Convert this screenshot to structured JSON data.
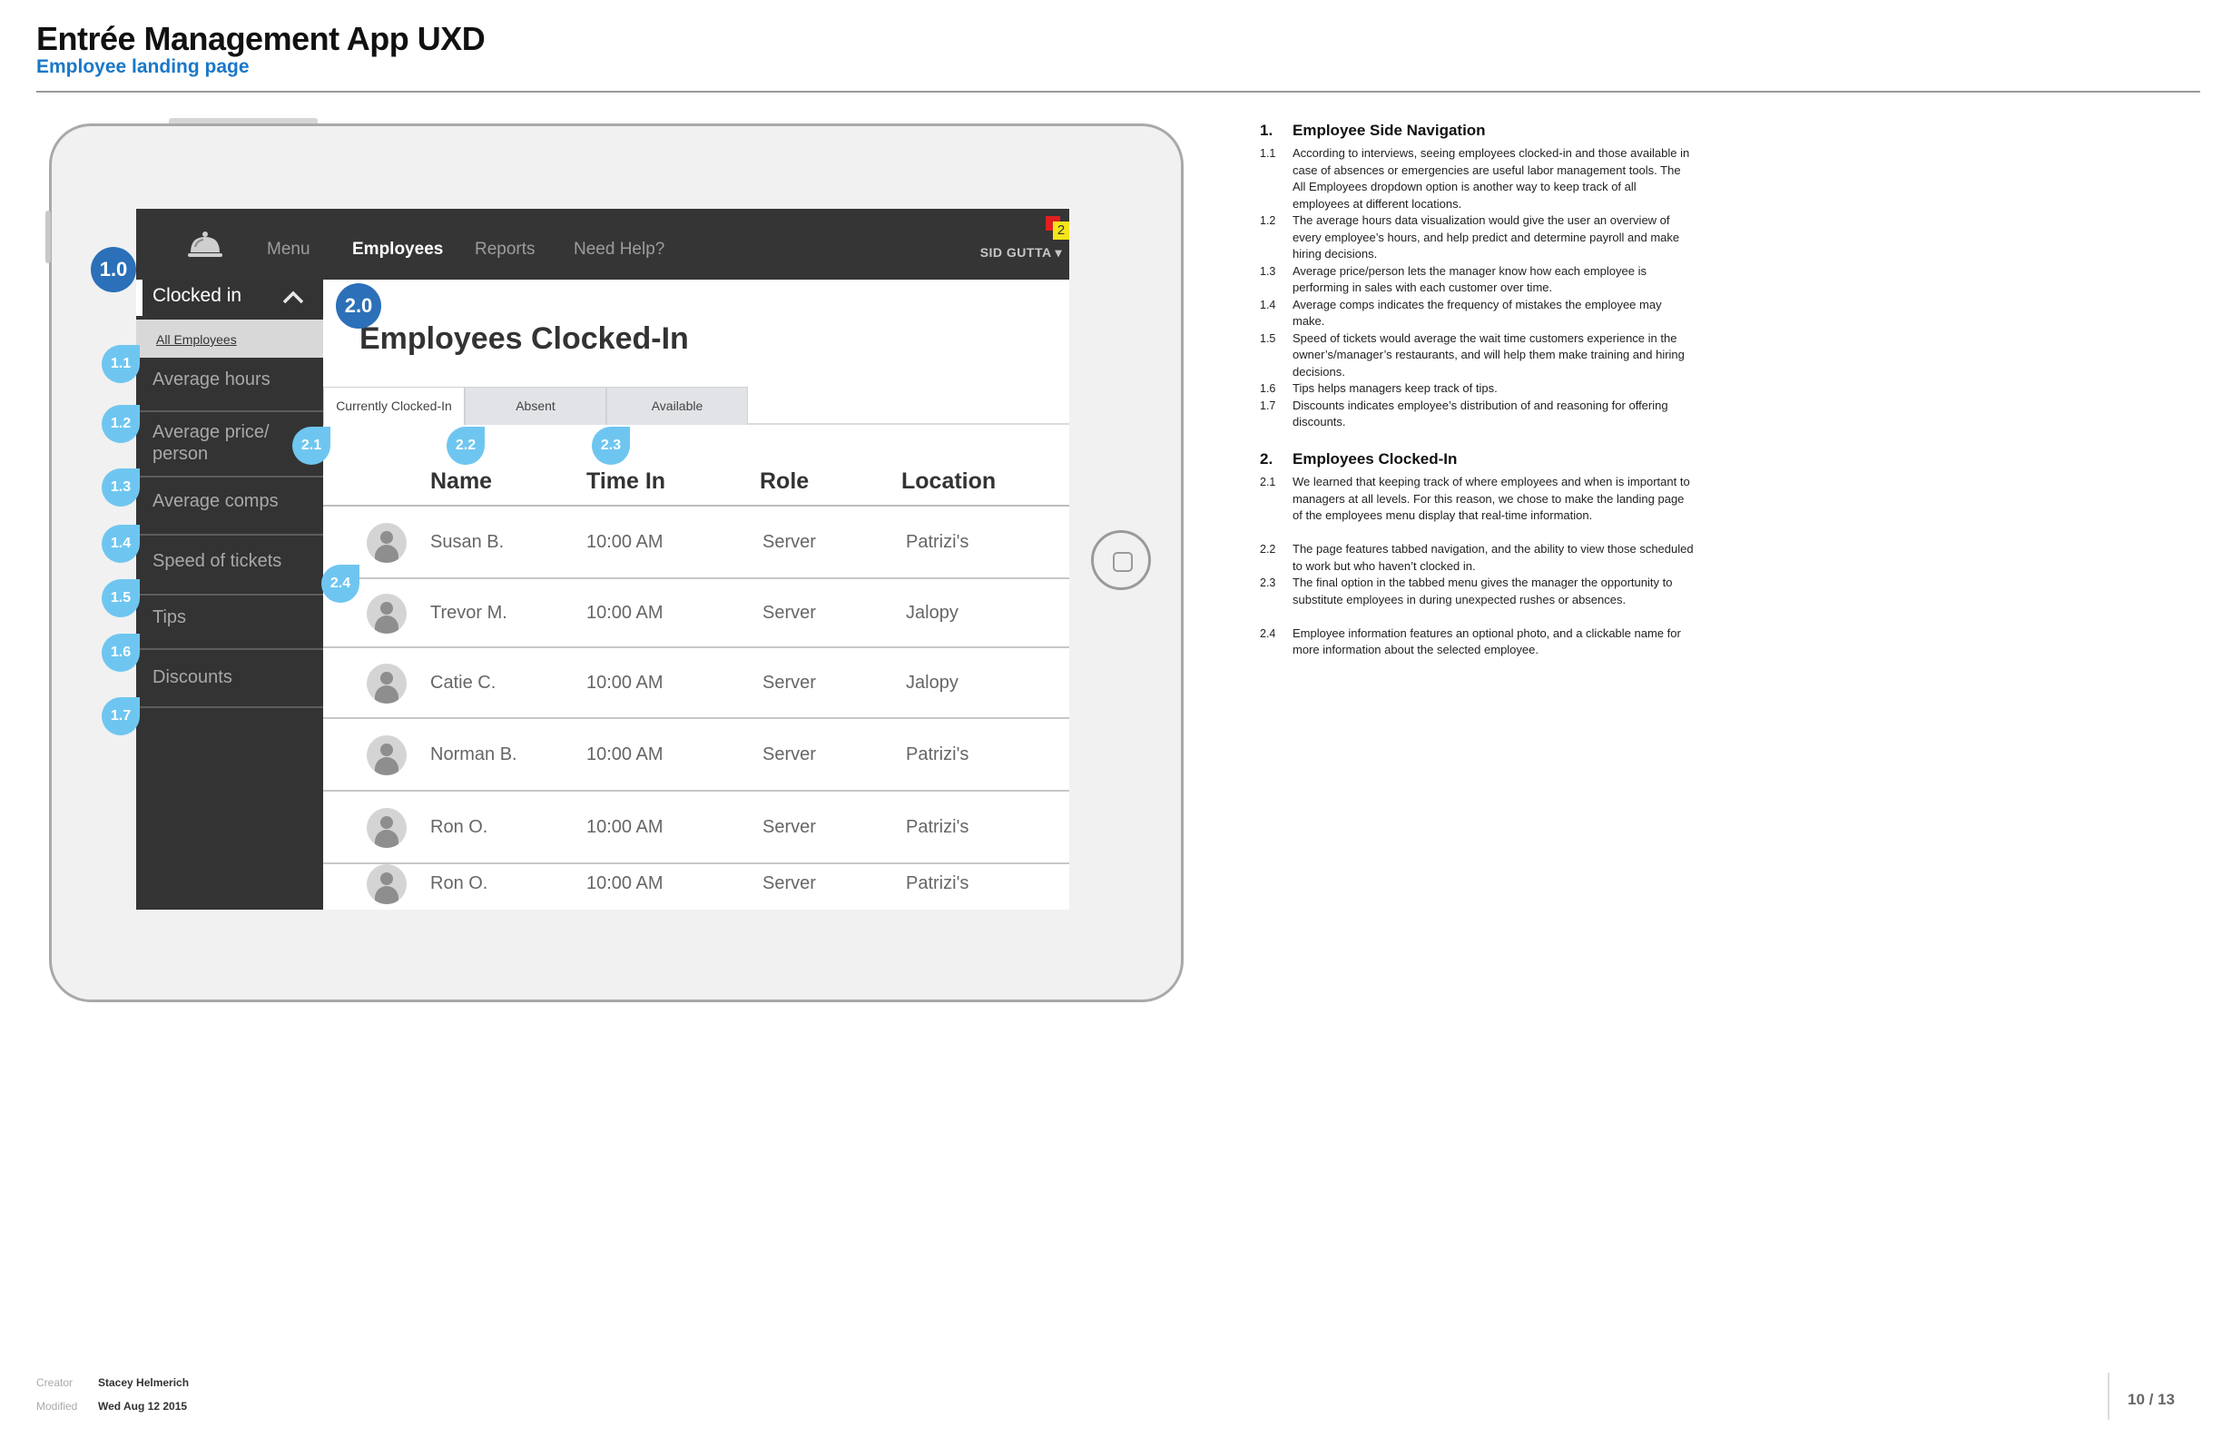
{
  "doc": {
    "title": "Entrée Management App UXD",
    "subtitle": "Employee landing page"
  },
  "app": {
    "nav": {
      "menu": "Menu",
      "employees": "Employees",
      "reports": "Reports",
      "help": "Need Help?"
    },
    "user_menu": "SID GUTTA ▾",
    "notification_count": "2",
    "sidebar": {
      "header": "Clocked in",
      "all_employees": "All Employees",
      "items": [
        "Average hours",
        "Average price/\nperson",
        "Average comps",
        "Speed of tickets",
        "Tips",
        "Discounts"
      ]
    },
    "heading": "Employees Clocked-In",
    "tabs": [
      "Currently Clocked-In",
      "Absent",
      "Available"
    ],
    "columns": [
      "Name",
      "Time In",
      "Role",
      "Location"
    ],
    "rows": [
      {
        "name": "Susan B.",
        "time": "10:00 AM",
        "role": "Server",
        "location": "Patrizi's"
      },
      {
        "name": "Trevor M.",
        "time": "10:00 AM",
        "role": "Server",
        "location": "Jalopy"
      },
      {
        "name": "Catie C.",
        "time": "10:00 AM",
        "role": "Server",
        "location": "Jalopy"
      },
      {
        "name": "Norman B.",
        "time": "10:00 AM",
        "role": "Server",
        "location": "Patrizi's"
      },
      {
        "name": "Ron O.",
        "time": "10:00 AM",
        "role": "Server",
        "location": "Patrizi's"
      },
      {
        "name": "Ron O.",
        "time": "10:00 AM",
        "role": "Server",
        "location": "Patrizi's"
      }
    ]
  },
  "markers": {
    "big": [
      "1.0",
      "2.0"
    ],
    "pins": [
      "1.1",
      "1.2",
      "1.3",
      "1.4",
      "1.5",
      "1.6",
      "1.7",
      "2.1",
      "2.2",
      "2.3",
      "2.4"
    ]
  },
  "notes": {
    "sections": [
      {
        "num": "1.",
        "title": "Employee Side Navigation",
        "items": [
          {
            "num": "1.1",
            "text": "According to interviews, seeing employees clocked-in and those available in case of absences or emergencies are useful labor management tools. The All Employees dropdown option is another way to keep track of all employees at different locations."
          },
          {
            "num": "1.2",
            "text": "The average hours data visualization would give the user an overview of every employee’s hours, and help predict and determine payroll and make hiring decisions."
          },
          {
            "num": "1.3",
            "text": "Average price/person lets the manager know how each employee is performing in sales with each customer over time."
          },
          {
            "num": "1.4",
            "text": "Average comps indicates the frequency of mistakes the employee may make."
          },
          {
            "num": "1.5",
            "text": "Speed of tickets would average the wait time customers experience in the owner’s/manager’s restaurants, and will help them make training and hiring decisions."
          },
          {
            "num": "1.6",
            "text": "Tips helps managers keep track of tips."
          },
          {
            "num": "1.7",
            "text": "Discounts indicates employee’s distribution of and reasoning for offering discounts."
          }
        ]
      },
      {
        "num": "2.",
        "title": "Employees Clocked-In",
        "items": [
          {
            "num": "2.1",
            "text": "We learned that keeping track of where employees and when is important to managers at all levels. For this reason, we chose to make the landing page of the employees menu display that real-time information."
          },
          {
            "num": "2.2",
            "text": "The page features tabbed navigation, and the ability to view those scheduled to work but who haven’t clocked in."
          },
          {
            "num": "2.3",
            "text": "The final option in the tabbed menu gives the manager the opportunity to substitute employees in during unexpected rushes or absences."
          },
          {
            "num": "2.4",
            "text": "Employee information features an optional photo, and a clickable name for more information about the selected employee."
          }
        ]
      }
    ]
  },
  "footer": {
    "creator_label": "Creator",
    "creator": "Stacey Helmerich",
    "modified_label": "Modified",
    "modified": "Wed Aug 12 2015",
    "page": "10 / 13"
  },
  "colors": {
    "accent_blue": "#1a78c8",
    "marker_blue": "#2b70b8",
    "pin_blue": "#6ec6f0",
    "app_dark": "#353535"
  }
}
